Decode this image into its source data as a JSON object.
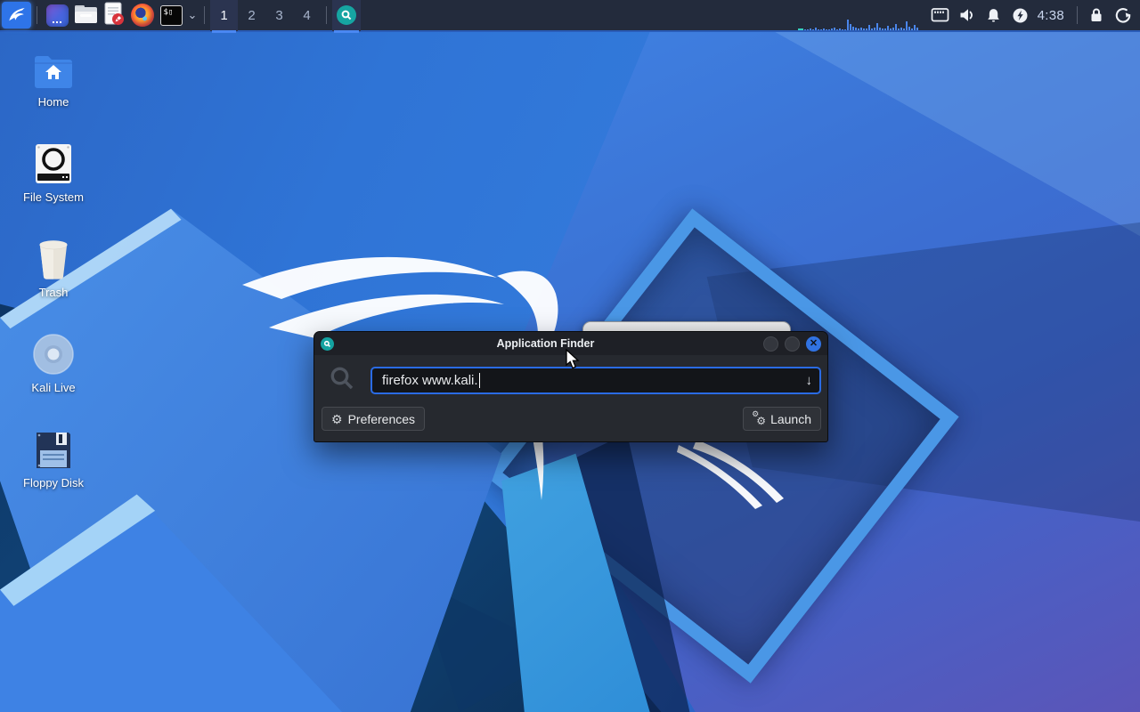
{
  "panel": {
    "menu": {
      "icon": "kali-dragon-icon"
    },
    "launchers": [
      {
        "icon": "window-app-icon"
      },
      {
        "icon": "file-manager-icon"
      },
      {
        "icon": "text-editor-icon"
      },
      {
        "icon": "firefox-icon"
      },
      {
        "icon": "terminal-icon"
      }
    ],
    "terminal_dropdown_glyph": "⌄",
    "workspaces": {
      "items": [
        "1",
        "2",
        "3",
        "4"
      ],
      "active": "1"
    },
    "taskbar": [
      {
        "icon": "app-finder-icon",
        "active": true
      }
    ],
    "cpu_graph": {
      "icon": "cpu-graph",
      "bars": [
        2,
        1,
        1,
        2,
        1,
        3,
        1,
        1,
        2,
        1,
        1,
        2,
        3,
        1,
        2,
        1,
        1,
        12,
        7,
        4,
        3,
        2,
        3,
        2,
        2,
        6,
        2,
        3,
        8,
        3,
        2,
        2,
        5,
        2,
        3,
        7,
        2,
        3,
        2,
        10,
        4,
        2,
        6,
        3
      ]
    },
    "tray": [
      {
        "icon": "display-icon"
      },
      {
        "icon": "volume-icon"
      },
      {
        "icon": "notifications-bell-icon"
      },
      {
        "icon": "power-manager-icon"
      }
    ],
    "clock": "4:38",
    "actions": [
      {
        "icon": "lock-icon"
      },
      {
        "icon": "logout-icon"
      }
    ]
  },
  "desktop": {
    "icons": [
      {
        "label": "Home",
        "icon": "home-folder-icon"
      },
      {
        "label": "File System",
        "icon": "hard-drive-icon"
      },
      {
        "label": "Trash",
        "icon": "trash-can-icon"
      },
      {
        "label": "Kali Live",
        "icon": "cd-disc-icon"
      },
      {
        "label": "Floppy Disk",
        "icon": "floppy-disk-icon"
      }
    ]
  },
  "app_finder": {
    "title": "Application Finder",
    "window_icon": "app-finder-icon",
    "search": {
      "value": "firefox www.kali.",
      "icon": "search-icon",
      "dropdown_icon": "arrow-down-icon"
    },
    "buttons": {
      "preferences": "Preferences",
      "launch": "Launch"
    },
    "close_glyph": "✕"
  },
  "colors": {
    "accent_blue": "#2a6be4",
    "panel_bg": "#232b3c",
    "underline_active": "#4a87f2",
    "finder_teal": "#16a5a2",
    "wallpaper_purple": "#5b55b8",
    "wallpaper_dark": "#0d3160"
  }
}
